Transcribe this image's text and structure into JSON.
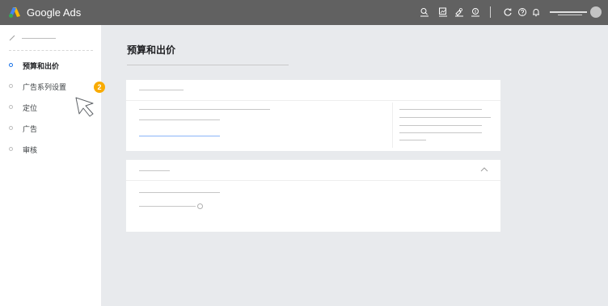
{
  "header": {
    "brand": "Google Ads",
    "icons": [
      "search-icon",
      "reports-icon",
      "tools-icon",
      "billing-icon",
      "refresh-icon",
      "help-icon",
      "notifications-icon"
    ]
  },
  "sidebar": {
    "items": [
      {
        "label": "预算和出价",
        "active": true
      },
      {
        "label": "广告系列设置",
        "active": false
      },
      {
        "label": "定位",
        "active": false
      },
      {
        "label": "广告",
        "active": false
      },
      {
        "label": "审核",
        "active": false
      }
    ],
    "step_badge": "2"
  },
  "main": {
    "title": "预算和出价"
  },
  "colors": {
    "topbar": "#616161",
    "accent": "#1a73e8",
    "badge": "#f9ab00",
    "background": "#e8eaed"
  }
}
